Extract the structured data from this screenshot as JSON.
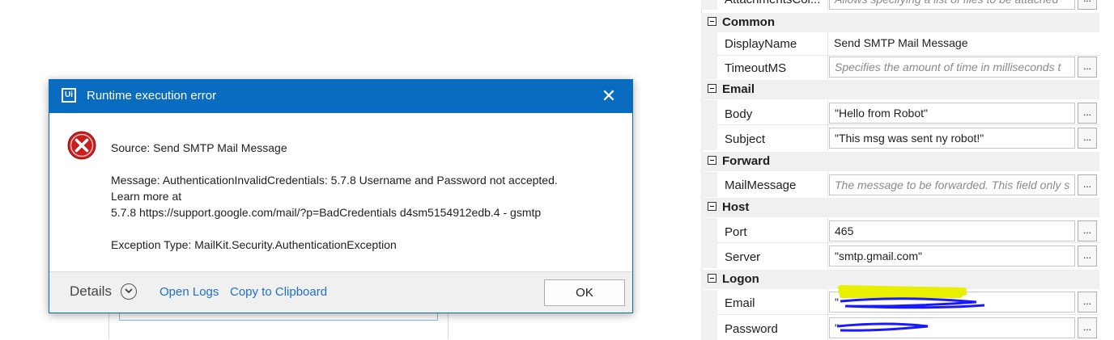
{
  "dialog": {
    "title": "Runtime execution error",
    "logo_text": "Ui",
    "close_glyph": "✕",
    "source_line": "Source: Send SMTP Mail Message",
    "message_line1": "Message: AuthenticationInvalidCredentials: 5.7.8 Username and Password not accepted.",
    "message_line2": "Learn more at",
    "message_line3": "5.7.8  https://support.google.com/mail/?p=BadCredentials d4sm5154912edb.4 - gsmtp",
    "exception_line": "Exception Type: MailKit.Security.AuthenticationException",
    "footer": {
      "details_label": "Details",
      "open_logs_label": "Open Logs",
      "copy_label": "Copy to Clipboard",
      "ok_label": "OK"
    },
    "colors": {
      "titlebar": "#0a6cc0",
      "link": "#1f6fc5",
      "error_red": "#c81e1e"
    }
  },
  "properties": {
    "top_row": {
      "name": "AttachmentsCol...",
      "placeholder": "Allows specifying a list of files to be attached"
    },
    "sections": {
      "common": {
        "label": "Common",
        "display_name": {
          "name": "DisplayName",
          "value": "Send SMTP Mail Message"
        },
        "timeout": {
          "name": "TimeoutMS",
          "placeholder": "Specifies the amount of time in milliseconds t"
        }
      },
      "email": {
        "label": "Email",
        "body": {
          "name": "Body",
          "value": "\"Hello from Robot\""
        },
        "subject": {
          "name": "Subject",
          "value": "\"This msg was sent ny robot!\""
        }
      },
      "forward": {
        "label": "Forward",
        "mail_message": {
          "name": "MailMessage",
          "placeholder": "The message to be forwarded. This field only s"
        }
      },
      "host": {
        "label": "Host",
        "port": {
          "name": "Port",
          "value": "465"
        },
        "server": {
          "name": "Server",
          "value": "\"smtp.gmail.com\""
        }
      },
      "logon": {
        "label": "Logon",
        "email": {
          "name": "Email",
          "value": "\""
        },
        "password": {
          "name": "Password",
          "value": "\""
        }
      }
    },
    "ellipsis": "..."
  }
}
